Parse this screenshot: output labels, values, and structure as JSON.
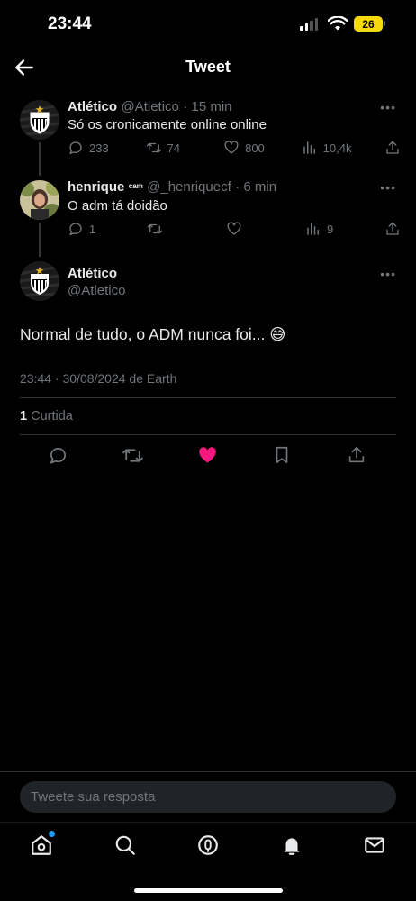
{
  "status": {
    "time": "23:44",
    "battery": "26"
  },
  "header": {
    "title": "Tweet"
  },
  "tweets": [
    {
      "name": "Atlético",
      "handle": "@Atletico",
      "time": "· 15 min",
      "text": "Só os cronicamente online online",
      "replies": "233",
      "retweets": "74",
      "likes": "800",
      "views": "10,4k"
    },
    {
      "name": "henrique",
      "badge": "ᶜᵃᵐ",
      "handle": "@_henriquecf",
      "time": "· 6 min",
      "text": "O adm tá doidão",
      "replies": "1",
      "retweets": "",
      "likes": "",
      "views": "9"
    }
  ],
  "main_tweet": {
    "name": "Atlético",
    "handle": "@Atletico",
    "text": "Normal de tudo, o ADM nunca foi... 😅",
    "timestamp": "23:44 · 30/08/2024 de Earth",
    "likes_count": "1",
    "likes_label": "Curtida"
  },
  "reply": {
    "placeholder": "Tweete sua resposta"
  },
  "icons": {
    "reply": "reply-icon",
    "retweet": "retweet-icon",
    "like": "heart-icon",
    "views": "views-icon",
    "share": "share-icon",
    "bookmark": "bookmark-icon"
  },
  "colors": {
    "like_active": "#f91880",
    "notification_dot": "#1d9bf0",
    "battery": "#f5d90a"
  }
}
